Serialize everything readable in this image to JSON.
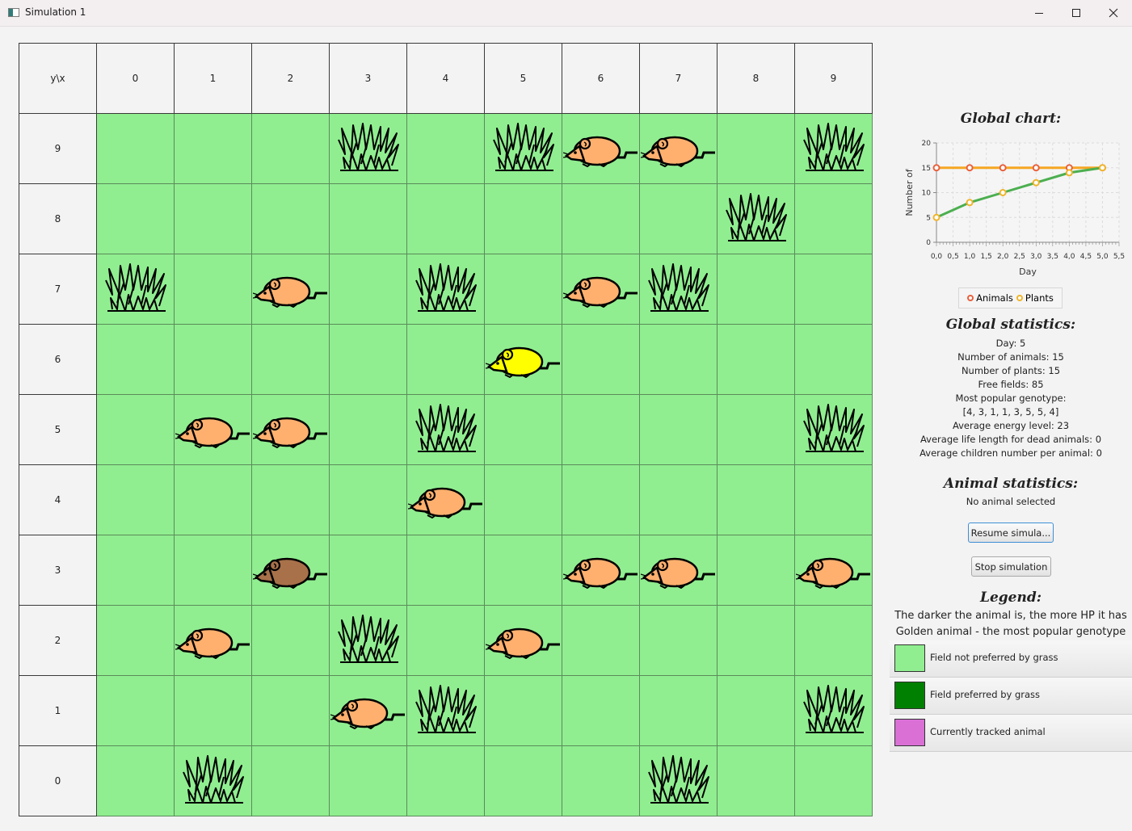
{
  "window": {
    "title": "Simulation 1"
  },
  "grid": {
    "corner_label": "y\\x",
    "x_headers": [
      "0",
      "1",
      "2",
      "3",
      "4",
      "5",
      "6",
      "7",
      "8",
      "9"
    ],
    "rows": [
      {
        "y": "9",
        "cells": [
          "",
          "",
          "",
          "plant",
          "",
          "plant",
          "animal",
          "animal",
          "",
          "plant"
        ]
      },
      {
        "y": "8",
        "cells": [
          "",
          "",
          "",
          "",
          "",
          "",
          "",
          "",
          "plant",
          ""
        ]
      },
      {
        "y": "7",
        "cells": [
          "plant",
          "",
          "animal",
          "",
          "plant",
          "",
          "animal",
          "plant",
          "",
          ""
        ]
      },
      {
        "y": "6",
        "cells": [
          "",
          "",
          "",
          "",
          "",
          "animal-golden",
          "",
          "",
          "",
          ""
        ]
      },
      {
        "y": "5",
        "cells": [
          "",
          "animal",
          "animal",
          "",
          "plant",
          "",
          "",
          "",
          "",
          "plant"
        ]
      },
      {
        "y": "4",
        "cells": [
          "",
          "",
          "",
          "",
          "animal",
          "",
          "",
          "",
          "",
          ""
        ]
      },
      {
        "y": "3",
        "cells": [
          "",
          "",
          "animal-dark",
          "",
          "",
          "",
          "animal",
          "animal",
          "",
          "animal"
        ]
      },
      {
        "y": "2",
        "cells": [
          "",
          "animal",
          "",
          "plant",
          "",
          "animal",
          "",
          "",
          "",
          ""
        ]
      },
      {
        "y": "1",
        "cells": [
          "",
          "",
          "",
          "animal",
          "plant",
          "",
          "",
          "",
          "",
          "plant"
        ]
      },
      {
        "y": "0",
        "cells": [
          "",
          "plant",
          "",
          "",
          "",
          "",
          "",
          "plant",
          "",
          ""
        ]
      }
    ],
    "colors": {
      "field": "#90ee90",
      "animal": "#ffb06e",
      "animal_dark": "#a8714a",
      "animal_golden": "#ffff00"
    }
  },
  "global_chart": {
    "heading": "Global chart:"
  },
  "chart_data": {
    "type": "line",
    "xlabel": "Day",
    "ylabel": "Number of",
    "xlim": [
      0,
      5.5
    ],
    "ylim": [
      0,
      20
    ],
    "x_ticks": [
      "0,0",
      "0,5",
      "1,0",
      "1,5",
      "2,0",
      "2,5",
      "3,0",
      "3,5",
      "4,0",
      "4,5",
      "5,0",
      "5,5"
    ],
    "y_ticks": [
      "0",
      "5",
      "10",
      "15",
      "20"
    ],
    "grid": true,
    "legend": "bottom",
    "series": [
      {
        "name": "Animals",
        "color": "#f5a623",
        "marker": "#e8603c",
        "x": [
          0,
          1,
          2,
          3,
          4,
          5
        ],
        "values": [
          15,
          15,
          15,
          15,
          15,
          15
        ]
      },
      {
        "name": "Plants",
        "color": "#4caf50",
        "marker": "#f0b429",
        "x": [
          0,
          1,
          2,
          3,
          4,
          5
        ],
        "values": [
          5,
          8,
          10,
          12,
          14,
          15
        ]
      }
    ]
  },
  "global_stats": {
    "heading": "Global statistics:",
    "day": "Day: 5",
    "animals": "Number of animals: 15",
    "plants": "Number of plants: 15",
    "free_fields": "Free fields: 85",
    "genotype_label": "Most popular genotype:",
    "genotype_value": "[4, 3, 1, 1, 3, 5, 5, 4]",
    "avg_energy": "Average energy level: 23",
    "avg_life": "Average life length for dead animals: 0",
    "avg_children": "Average children number per animal: 0"
  },
  "animal_stats": {
    "heading": "Animal statistics:",
    "selected": "No animal selected"
  },
  "buttons": {
    "resume": "Resume simula...",
    "stop": "Stop simulation"
  },
  "legend": {
    "heading": "Legend:",
    "line1": "The darker the animal is, the more HP it has",
    "line2": "Golden animal - the most popular genotype",
    "items": [
      {
        "label": "Field not preferred by grass",
        "color": "#90ee90"
      },
      {
        "label": "Field preferred by grass",
        "color": "#008000"
      },
      {
        "label": "Currently tracked animal",
        "color": "#da70d6"
      }
    ]
  }
}
